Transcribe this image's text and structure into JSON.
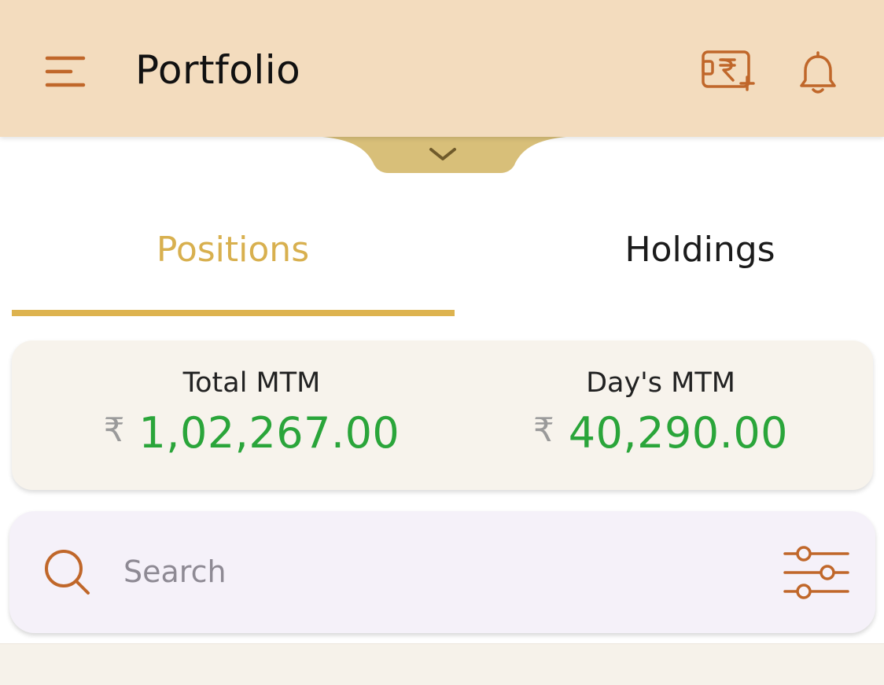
{
  "header": {
    "title": "Portfolio",
    "icons": {
      "menu": "menu-icon",
      "funds": "rupee-add-funds-icon",
      "notifications": "bell-icon"
    }
  },
  "drawer_toggle": {
    "icon": "chevron-down-icon"
  },
  "tabs": [
    {
      "label": "Positions",
      "active": true
    },
    {
      "label": "Holdings",
      "active": false
    }
  ],
  "mtm": {
    "total": {
      "label": "Total MTM",
      "currency": "₹",
      "value": "1,02,267.00"
    },
    "day": {
      "label": "Day's MTM",
      "currency": "₹",
      "value": "40,290.00"
    }
  },
  "search": {
    "placeholder": "Search",
    "value": "",
    "icons": {
      "search": "search-icon",
      "filter": "filter-sliders-icon"
    }
  },
  "colors": {
    "appbar": "#f3dcbe",
    "accent": "#ddb34f",
    "icon": "#c0672a",
    "positive": "#2aa53a",
    "card": "#f7f3ec",
    "search_bg": "#f5f1f9"
  }
}
